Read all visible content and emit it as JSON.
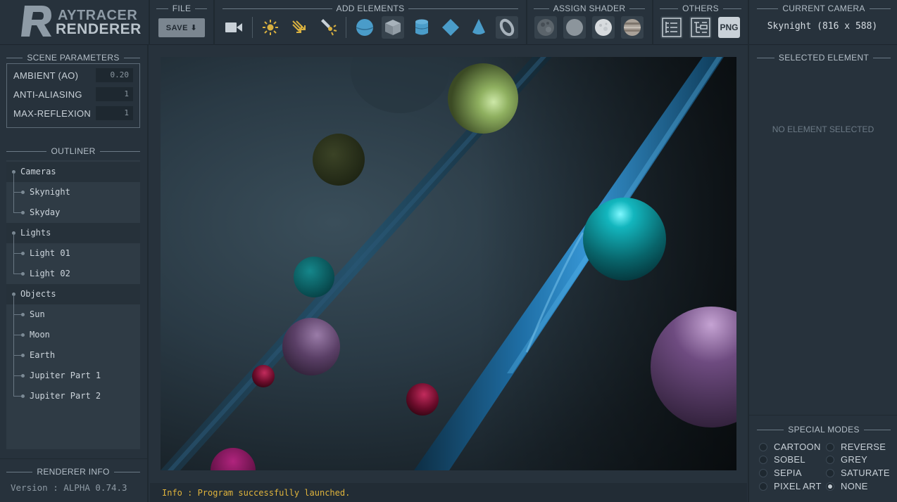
{
  "logo": {
    "line1": "AYTRACER",
    "line2": "RENDERER",
    "initial": "R"
  },
  "toolbar": {
    "file_title": "FILE",
    "save_label": "SAVE ⬇",
    "add_title": "ADD ELEMENTS",
    "shader_title": "ASSIGN SHADER",
    "others_title": "OTHERS",
    "png_label": "PNG",
    "camera_title": "CURRENT CAMERA",
    "camera_value": "Skynight (816 x 588)",
    "add_icons": [
      "camera-icon",
      "point-light-icon",
      "directional-light-icon",
      "spot-light-icon",
      "sphere-icon",
      "cube-icon",
      "cylinder-icon",
      "plane-icon",
      "cone-icon",
      "torus-icon"
    ],
    "shader_icons": [
      "moon-shader-icon",
      "grey-shader-icon",
      "marble-shader-icon",
      "jupiter-shader-icon"
    ],
    "other_icons": [
      "list-view-icon",
      "tree-view-icon",
      "png-export-icon"
    ]
  },
  "scene_params": {
    "title": "SCENE PARAMETERS",
    "rows": [
      {
        "label": "AMBIENT (AO)",
        "value": "0.20"
      },
      {
        "label": "ANTI-ALIASING",
        "value": "1"
      },
      {
        "label": "MAX-REFLEXION",
        "value": "1"
      }
    ]
  },
  "outliner": {
    "title": "OUTLINER",
    "groups": [
      {
        "label": "Cameras",
        "children": [
          "Skynight",
          "Skyday"
        ]
      },
      {
        "label": "Lights",
        "children": [
          "Light 01",
          "Light 02"
        ]
      },
      {
        "label": "Objects",
        "children": [
          "Sun",
          "Moon",
          "Earth",
          "Jupiter Part 1",
          "Jupiter Part 2"
        ]
      }
    ]
  },
  "renderer_info": {
    "title": "RENDERER INFO",
    "version": "Version : ALPHA 0.74.3"
  },
  "status": {
    "text": "Info : Program successfully launched."
  },
  "selected": {
    "title": "SELECTED ELEMENT",
    "empty": "NO ELEMENT SELECTED"
  },
  "modes": {
    "title": "SPECIAL MODES",
    "items": [
      {
        "label": "CARTOON",
        "on": false
      },
      {
        "label": "REVERSE",
        "on": false
      },
      {
        "label": "SOBEL",
        "on": false
      },
      {
        "label": "GREY",
        "on": false
      },
      {
        "label": "SEPIA",
        "on": false
      },
      {
        "label": "SATURATE",
        "on": false
      },
      {
        "label": "PIXEL ART",
        "on": false
      },
      {
        "label": "NONE",
        "on": true
      }
    ]
  },
  "colors": {
    "accent": "#4a9cc9",
    "status": "#e0b43c",
    "light_icon": "#d8b040"
  }
}
